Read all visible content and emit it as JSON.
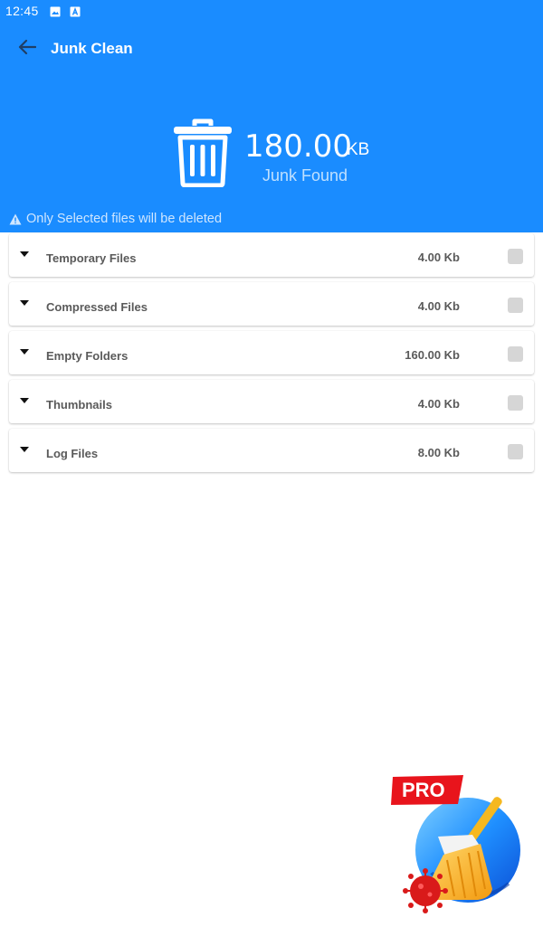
{
  "status_bar": {
    "time": "12:45",
    "icons": [
      "image-icon",
      "a-icon"
    ]
  },
  "app_bar": {
    "title": "Junk Clean",
    "back_icon": "arrow-left-icon"
  },
  "summary": {
    "size_value": "180.00",
    "size_unit": "KB",
    "label": "Junk Found",
    "icon": "trash-icon"
  },
  "notice": {
    "text": "Only Selected files will be deleted",
    "icon": "warning-icon"
  },
  "items": [
    {
      "name": "Temporary Files",
      "size": "4.00 Kb",
      "checked": false
    },
    {
      "name": "Compressed Files",
      "size": "4.00 Kb",
      "checked": false
    },
    {
      "name": "Empty Folders",
      "size": "160.00 Kb",
      "checked": false
    },
    {
      "name": "Thumbnails",
      "size": "4.00 Kb",
      "checked": false
    },
    {
      "name": "Log Files",
      "size": "8.00 Kb",
      "checked": false
    }
  ],
  "promo": {
    "badge_text": "PRO"
  },
  "colors": {
    "primary": "#1a8cff",
    "text_muted": "#5a5a5a",
    "checkbox": "#d6d6d6",
    "pro_red": "#e8141c",
    "broom_yellow": "#f5b820"
  }
}
